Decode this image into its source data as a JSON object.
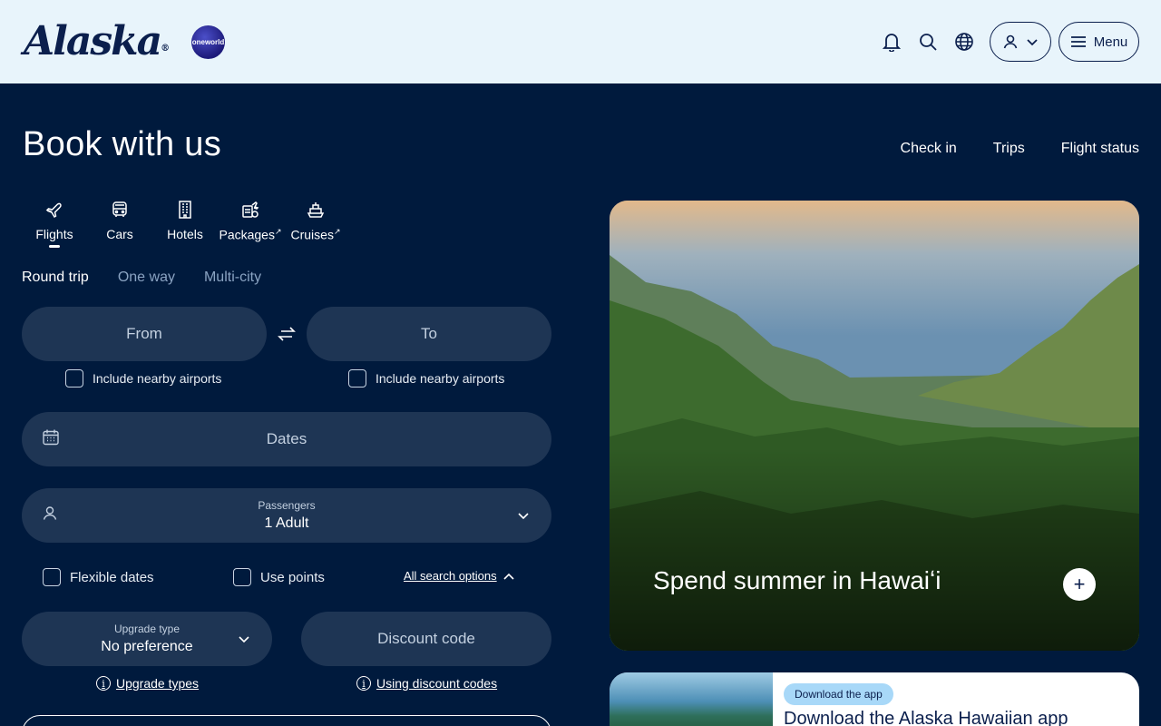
{
  "brand": {
    "name": "Alaska",
    "partner": "oneworld"
  },
  "header": {
    "icons": [
      "bell-icon",
      "search-icon",
      "globe-icon",
      "user-icon"
    ],
    "menu_label": "Menu"
  },
  "page": {
    "title": "Book with us",
    "top_links": [
      "Check in",
      "Trips",
      "Flight status"
    ]
  },
  "categories": [
    {
      "label": "Flights",
      "icon": "plane-icon",
      "external": false,
      "active": true
    },
    {
      "label": "Cars",
      "icon": "car-icon",
      "external": false,
      "active": false
    },
    {
      "label": "Hotels",
      "icon": "hotel-icon",
      "external": false,
      "active": false
    },
    {
      "label": "Packages",
      "icon": "package-icon",
      "external": true,
      "active": false
    },
    {
      "label": "Cruises",
      "icon": "cruise-icon",
      "external": true,
      "active": false
    }
  ],
  "trip_types": {
    "selected": "Round trip",
    "options": [
      "Round trip",
      "One way",
      "Multi-city"
    ]
  },
  "search": {
    "from_placeholder": "From",
    "to_placeholder": "To",
    "nearby_label": "Include nearby airports",
    "dates_placeholder": "Dates",
    "passengers_label": "Passengers",
    "passengers_value": "1 Adult",
    "flexible_dates_label": "Flexible dates",
    "use_points_label": "Use points",
    "all_options_label": "All search options",
    "upgrade_label": "Upgrade type",
    "upgrade_value": "No preference",
    "discount_placeholder": "Discount code",
    "upgrade_help": "Upgrade types",
    "discount_help": "Using discount codes"
  },
  "hero": {
    "title": "Spend summer in Hawaiʻi",
    "plus": "+"
  },
  "app_promo": {
    "badge": "Download the app",
    "title": "Download the Alaska Hawaiian app"
  }
}
